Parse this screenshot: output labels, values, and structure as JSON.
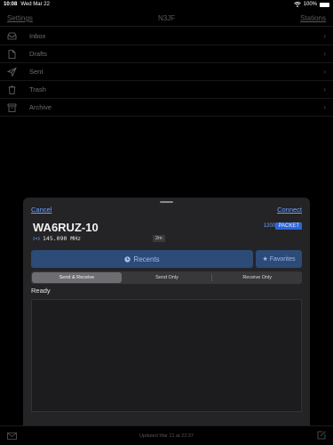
{
  "status_bar": {
    "time": "10:08",
    "date": "Wed Mar 22",
    "battery": "100%"
  },
  "nav": {
    "left": "Settings",
    "title": "N3JF",
    "right": "Stations"
  },
  "mailboxes": [
    {
      "label": "Inbox",
      "icon": "tray-icon"
    },
    {
      "label": "Drafts",
      "icon": "document-icon"
    },
    {
      "label": "Sent",
      "icon": "paper-plane-icon"
    },
    {
      "label": "Trash",
      "icon": "trash-icon"
    },
    {
      "label": "Archive",
      "icon": "archive-box-icon"
    }
  ],
  "sheet": {
    "cancel": "Cancel",
    "connect": "Connect",
    "station": "WA6RUZ-10",
    "frequency": "145.090 MHz",
    "band": "2m",
    "baud": "1200",
    "mode": "PACKET",
    "recents": "Recents",
    "favorites": "Favorites",
    "segments": [
      "Send & Receive",
      "Send Only",
      "Receive Only"
    ],
    "status": "Ready"
  },
  "toolbar": {
    "updated": "Updated Mar 21 at 22:37"
  },
  "colors": {
    "accent": "#6aa1ff",
    "button_bg": "#2c4b77",
    "packet_badge": "#2e66d8"
  }
}
